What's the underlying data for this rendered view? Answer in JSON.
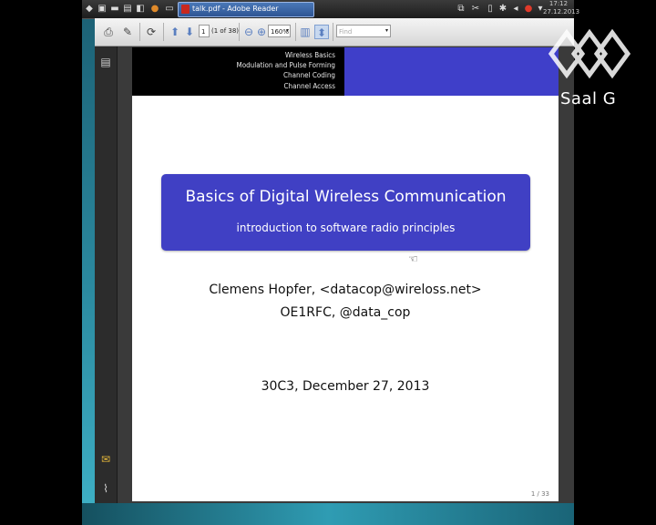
{
  "taskbar": {
    "window_label": "talk.pdf - Adobe Reader",
    "clock_time": "17:12",
    "clock_date": "27.12.2013"
  },
  "toolbar": {
    "page_input": "1",
    "page_count": "(1 of 38)",
    "zoom": "160%",
    "find_placeholder": "Find"
  },
  "slide": {
    "nav": [
      "Wireless Basics",
      "Modulation and Pulse Forming",
      "Channel Coding",
      "Channel Access"
    ],
    "title": "Basics of Digital Wireless Communication",
    "subtitle": "introduction to software radio principles",
    "author_line": "Clemens Hopfer, <datacop@wireloss.net>",
    "handle_line": "OE1RFC, @data_cop",
    "event_line": "30C3, December 27, 2013",
    "page_number": "1 / 33"
  },
  "overlay": {
    "caption": "Saal G"
  },
  "icons": {
    "taskbar": [
      "start-icon",
      "terminal-icon",
      "folder-icon",
      "browser-icon",
      "file-icon"
    ],
    "tray": [
      "network-icon",
      "tools-icon",
      "battery-icon",
      "bluetooth-icon",
      "volume-icon",
      "update-icon",
      "menu-arrow-icon"
    ],
    "toolbar": [
      "print-icon",
      "edit-icon",
      "save-icon",
      "prev-page-icon",
      "next-page-icon",
      "zoom-out-icon",
      "zoom-in-icon",
      "scroll-mode-icon",
      "fit-page-icon"
    ],
    "nav": [
      "pages-icon",
      "comments-icon",
      "attachments-icon"
    ]
  }
}
